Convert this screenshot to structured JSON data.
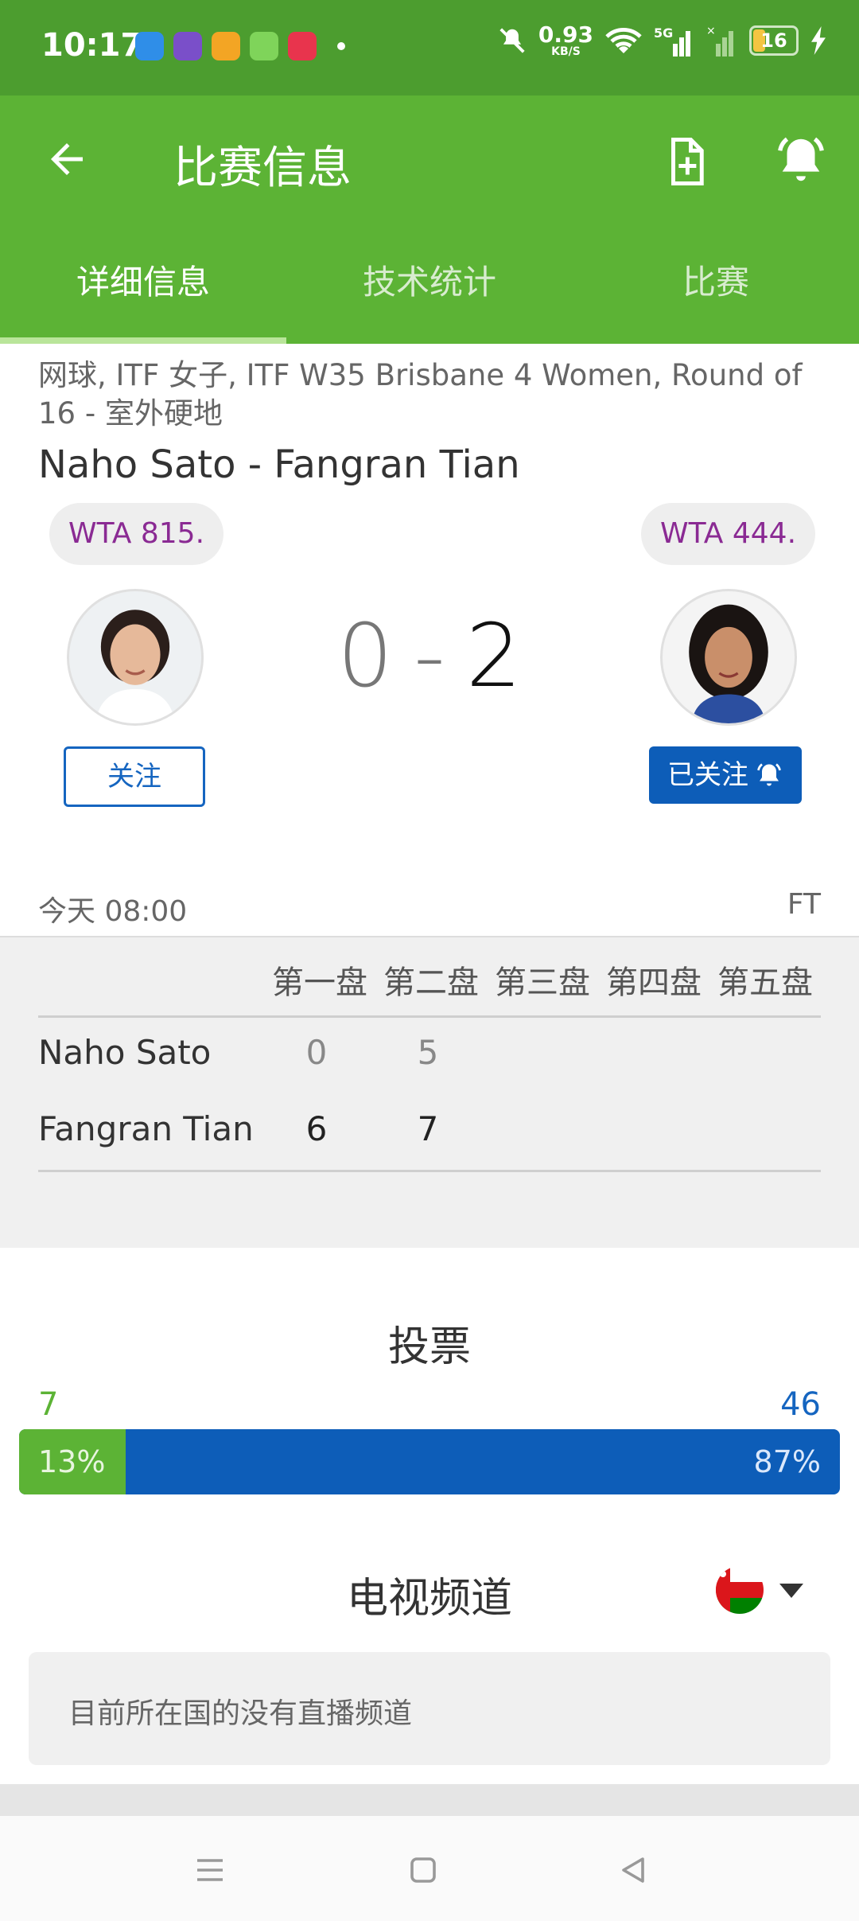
{
  "status_bar": {
    "time": "10:17",
    "net_speed": "0.93",
    "net_unit": "KB/S",
    "network_label": "5G",
    "battery_level": "16"
  },
  "app_bar": {
    "title": "比赛信息"
  },
  "tabs": [
    {
      "label": "详细信息",
      "active": true
    },
    {
      "label": "技术统计",
      "active": false
    },
    {
      "label": "比赛",
      "active": false
    }
  ],
  "match": {
    "league": "网球, ITF 女子, ITF W35 Brisbane 4 Women, Round of 16 - 室外硬地",
    "title": "Naho Sato - Fangran Tian",
    "home_rank": "WTA 815.",
    "away_rank": "WTA 444.",
    "home_score": "0",
    "separator": "-",
    "away_score": "2",
    "follow_label": "关注",
    "followed_label": "已关注",
    "time": "今天 08:00",
    "status": "FT"
  },
  "score_table": {
    "headers": [
      "第一盘",
      "第二盘",
      "第三盘",
      "第四盘",
      "第五盘"
    ],
    "rows": [
      {
        "player": "Naho Sato",
        "sets": [
          "0",
          "5"
        ]
      },
      {
        "player": "Fangran Tian",
        "sets": [
          "6",
          "7"
        ]
      }
    ]
  },
  "vote": {
    "title": "投票",
    "home_count": "7",
    "away_count": "46",
    "home_pct": "13%",
    "away_pct": "87%",
    "home_fraction": 0.13
  },
  "tv": {
    "title": "电视频道",
    "message": "目前所在国的没有直播频道"
  },
  "colors": {
    "status_bar": "#4c9d2f",
    "app_bar": "#5cb335",
    "brand_blue": "#0d5db8",
    "rank_text": "#8a2a93"
  }
}
